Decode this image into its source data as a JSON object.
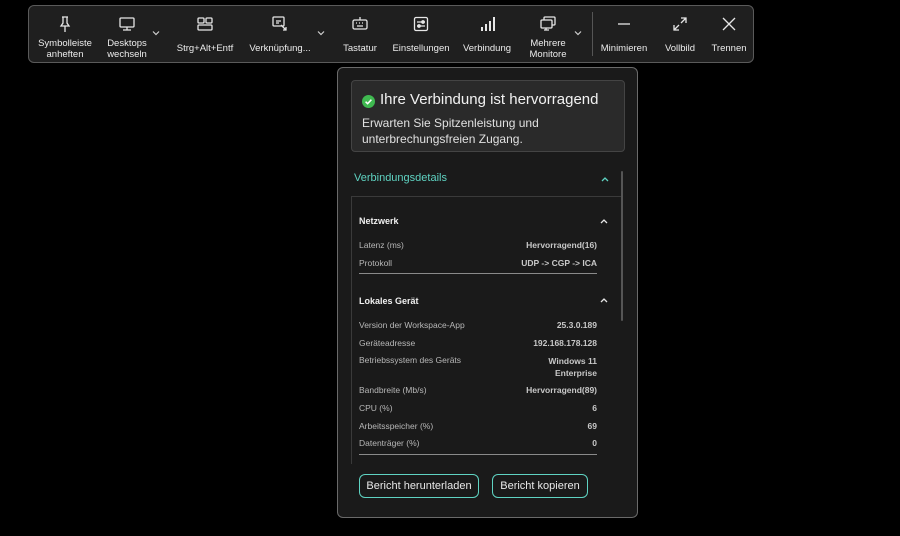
{
  "toolbar": {
    "items": [
      {
        "label_line1": "Symbolleiste",
        "label_line2": "anheften",
        "icon": "pin-icon"
      },
      {
        "label_line1": "Desktops",
        "label_line2": "wechseln",
        "icon": "monitor-icon"
      },
      {
        "label": "Strg+Alt+Entf",
        "icon": "ctrl-alt-del-icon"
      },
      {
        "label": "Verknüpfung...",
        "icon": "shortcut-icon"
      },
      {
        "label": "Tastatur",
        "icon": "keyboard-icon"
      },
      {
        "label": "Einstellungen",
        "icon": "settings-icon"
      },
      {
        "label": "Verbindung",
        "icon": "signal-bars-icon"
      },
      {
        "label_line1": "Mehrere",
        "label_line2": "Monitore",
        "icon": "multi-monitor-icon"
      },
      {
        "label": "Minimieren",
        "icon": "minimize-icon"
      },
      {
        "label": "Vollbild",
        "icon": "fullscreen-icon"
      },
      {
        "label": "Trennen",
        "icon": "close-icon"
      }
    ]
  },
  "panel": {
    "status_title": "Ihre Verbindung ist hervorragend",
    "status_desc": "Erwarten Sie Spitzenleistung und unterbrechungsfreien Zugang.",
    "details_header": "Verbindungsdetails",
    "network": {
      "title": "Netzwerk",
      "rows": [
        {
          "label": "Latenz (ms)",
          "value": "Hervorragend(16)"
        },
        {
          "label": "Protokoll",
          "value": "UDP -> CGP -> ICA"
        }
      ]
    },
    "device": {
      "title": "Lokales Gerät",
      "rows": [
        {
          "label": "Version der Workspace-App",
          "value": "25.3.0.189"
        },
        {
          "label": "Geräteadresse",
          "value": "192.168.178.128"
        },
        {
          "label": "Betriebssystem des Geräts",
          "value_line1": "Windows 11",
          "value_line2": "Enterprise"
        },
        {
          "label": "Bandbreite (Mb/s)",
          "value": "Hervorragend(89)"
        },
        {
          "label": "CPU (%)",
          "value": "6"
        },
        {
          "label": "Arbeitsspeicher (%)",
          "value": "69"
        },
        {
          "label": "Datenträger (%)",
          "value": "0"
        }
      ]
    },
    "download_button": "Bericht herunterladen",
    "copy_button": "Bericht kopieren"
  },
  "colors": {
    "accent": "#5fd3c2",
    "success": "#3fb950",
    "background": "#000000",
    "panel": "#1a1a1a"
  }
}
